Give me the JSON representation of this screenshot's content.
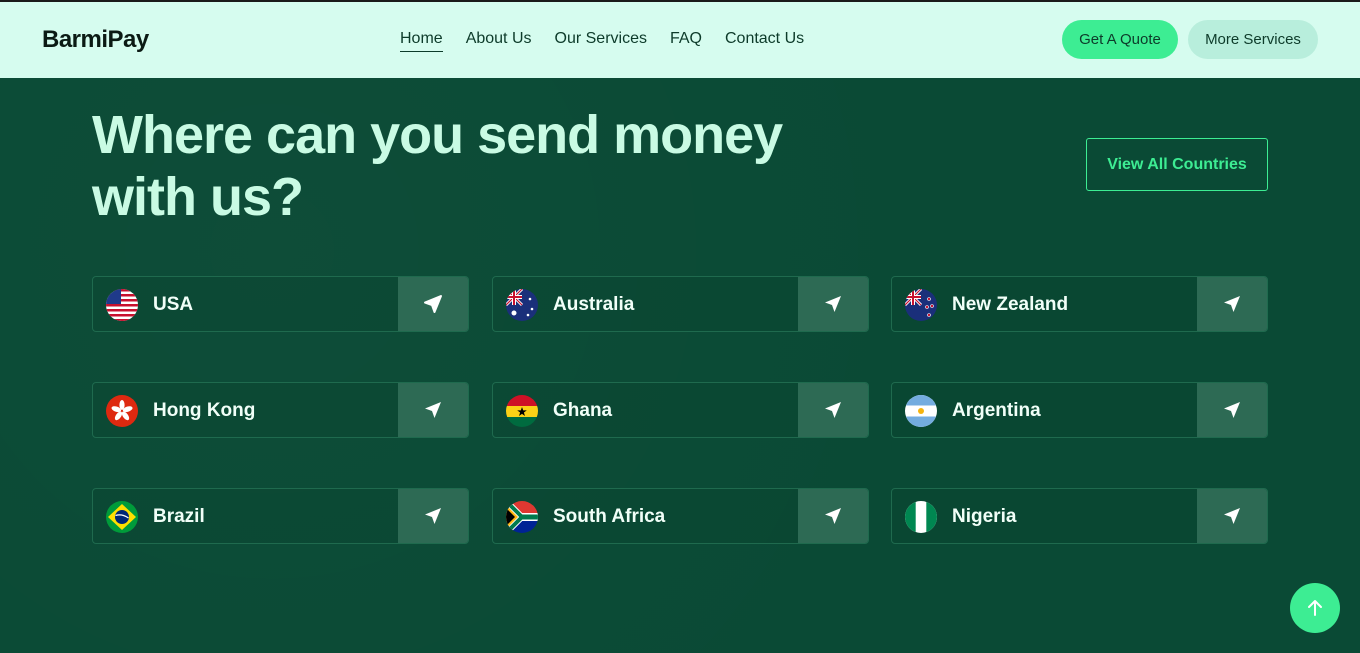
{
  "brand": "BarmiPay",
  "nav": [
    "Home",
    "About Us",
    "Our Services",
    "FAQ",
    "Contact Us"
  ],
  "header_buttons": {
    "quote": "Get A Quote",
    "more": "More Services"
  },
  "hero": {
    "title_line1": "Where can you send money",
    "title_line2": "with us?",
    "view_all": "View All Countries"
  },
  "countries": [
    "USA",
    "Australia",
    "New Zealand",
    "Hong Kong",
    "Ghana",
    "Argentina",
    "Brazil",
    "South Africa",
    "Nigeria"
  ],
  "colors": {
    "accent": "#3ded93",
    "header_bg": "#d6fcef",
    "section_bg": "#0a4a35"
  }
}
